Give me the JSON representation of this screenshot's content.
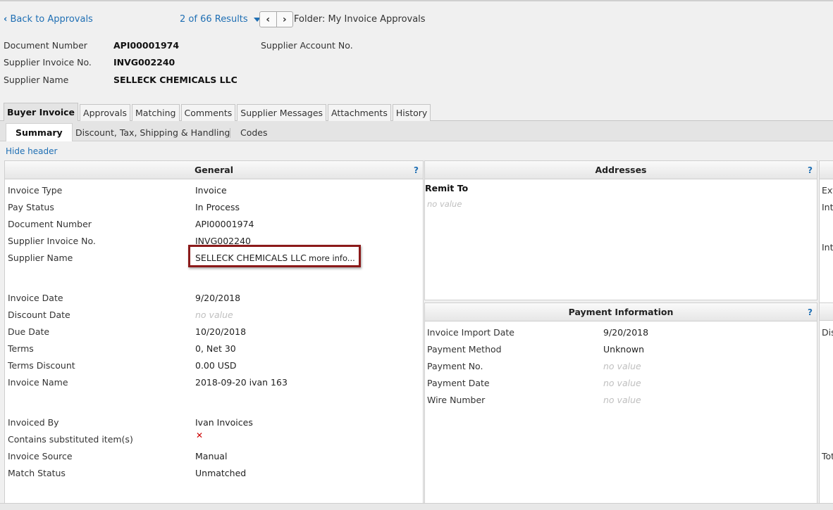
{
  "nav": {
    "back_label": "Back to Approvals",
    "results_label": "2 of 66 Results",
    "prev_icon": "‹",
    "next_icon": "›",
    "folder_label": "Folder: My Invoice Approvals"
  },
  "header": {
    "document_number_label": "Document Number",
    "document_number_value": "API00001974",
    "supplier_invoice_label": "Supplier Invoice No.",
    "supplier_invoice_value": "INVG002240",
    "supplier_name_label": "Supplier Name",
    "supplier_name_value": "SELLECK CHEMICALS LLC",
    "supplier_account_label": "Supplier Account No."
  },
  "tabs": [
    "Buyer Invoice",
    "Approvals",
    "Matching",
    "Comments",
    "Supplier Messages",
    "Attachments",
    "History"
  ],
  "subtabs": [
    "Summary",
    "Discount, Tax, Shipping & Handling",
    "Codes"
  ],
  "hide_header_label": "Hide header",
  "general": {
    "title": "General",
    "help": "?",
    "invoice_type_label": "Invoice Type",
    "invoice_type_value": "Invoice",
    "pay_status_label": "Pay Status",
    "pay_status_value": "In Process",
    "doc_number_label": "Document Number",
    "doc_number_value": "API00001974",
    "supplier_invoice_label": "Supplier Invoice No.",
    "supplier_invoice_value": "INVG002240",
    "supplier_name_label": "Supplier Name",
    "supplier_name_value": "SELLECK CHEMICALS LLC",
    "more_info_label": "more info...",
    "invoice_date_label": "Invoice Date",
    "invoice_date_value": "9/20/2018",
    "discount_date_label": "Discount Date",
    "discount_date_value": "no value",
    "due_date_label": "Due Date",
    "due_date_value": "10/20/2018",
    "terms_label": "Terms",
    "terms_value": "0, Net 30",
    "terms_discount_label": "Terms Discount",
    "terms_discount_value": "0.00 USD",
    "invoice_name_label": "Invoice Name",
    "invoice_name_value": "2018-09-20 ivan 163",
    "invoiced_by_label": "Invoiced By",
    "invoiced_by_value": "Ivan Invoices",
    "substituted_label": "Contains substituted item(s)",
    "substituted_icon": "✕",
    "invoice_source_label": "Invoice Source",
    "invoice_source_value": "Manual",
    "match_status_label": "Match Status",
    "match_status_value": "Unmatched"
  },
  "addresses": {
    "title": "Addresses",
    "help": "?",
    "remit_to_label": "Remit To",
    "remit_to_value": "no value"
  },
  "payment": {
    "title": "Payment Information",
    "help": "?",
    "import_date_label": "Invoice Import Date",
    "import_date_value": "9/20/2018",
    "method_label": "Payment Method",
    "method_value": "Unknown",
    "payment_no_label": "Payment No.",
    "payment_no_value": "no value",
    "payment_date_label": "Payment Date",
    "payment_date_value": "no value",
    "wire_label": "Wire Number",
    "wire_value": "no value"
  },
  "right_partial": {
    "ext": "Ext",
    "inte1": "Inte",
    "inte2": "Inte",
    "dis": "Dis",
    "tot": "Tot"
  },
  "colors": {
    "link": "#1f6fb4",
    "highlight_border": "#8b1a1a",
    "error_x": "#cc0000"
  }
}
